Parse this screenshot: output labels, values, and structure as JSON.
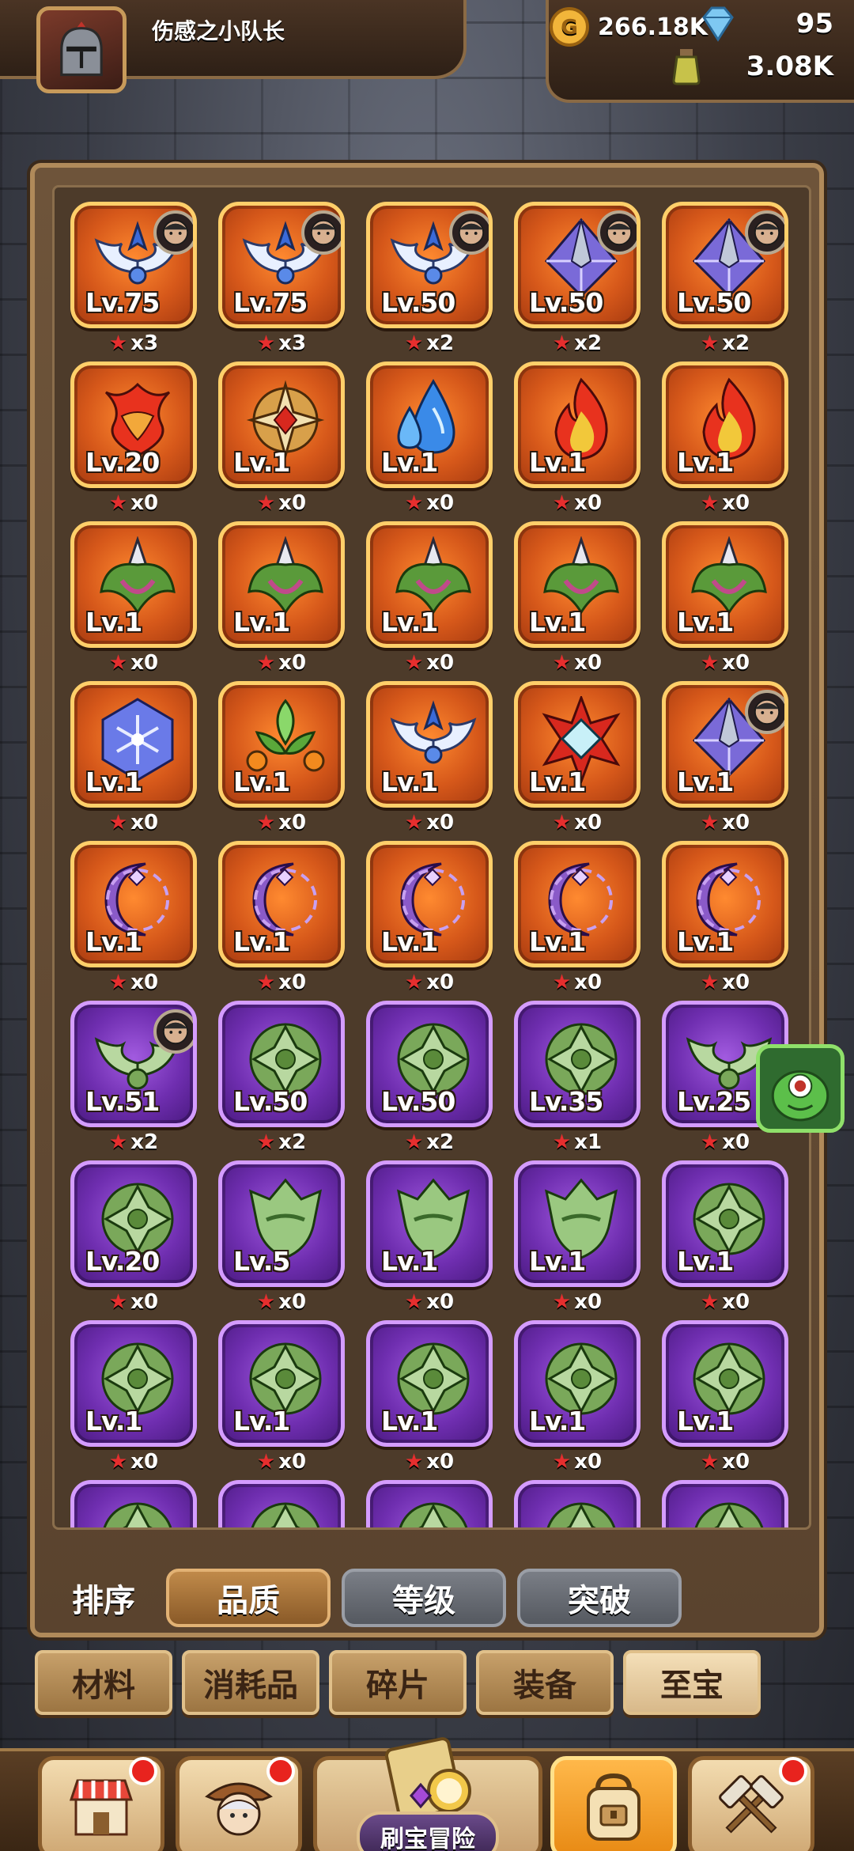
{
  "player": {
    "name": "伤感之小队长"
  },
  "resources": {
    "gold": "266.18K",
    "gems": "95",
    "potion": "3.08K"
  },
  "items": [
    {
      "lv": "Lv.75",
      "stars": "x3",
      "rarity": "orange",
      "art": "wings",
      "hero": true
    },
    {
      "lv": "Lv.75",
      "stars": "x3",
      "rarity": "orange",
      "art": "wings",
      "hero": true
    },
    {
      "lv": "Lv.50",
      "stars": "x2",
      "rarity": "orange",
      "art": "wings",
      "hero": true
    },
    {
      "lv": "Lv.50",
      "stars": "x2",
      "rarity": "orange",
      "art": "spike",
      "hero": true
    },
    {
      "lv": "Lv.50",
      "stars": "x2",
      "rarity": "orange",
      "art": "spike",
      "hero": true
    },
    {
      "lv": "Lv.20",
      "stars": "x0",
      "rarity": "orange",
      "art": "flame-mask",
      "hero": false
    },
    {
      "lv": "Lv.1",
      "stars": "x0",
      "rarity": "orange",
      "art": "cross",
      "hero": false
    },
    {
      "lv": "Lv.1",
      "stars": "x0",
      "rarity": "orange",
      "art": "water",
      "hero": false
    },
    {
      "lv": "Lv.1",
      "stars": "x0",
      "rarity": "orange",
      "art": "fire",
      "hero": false
    },
    {
      "lv": "Lv.1",
      "stars": "x0",
      "rarity": "orange",
      "art": "fire",
      "hero": false
    },
    {
      "lv": "Lv.1",
      "stars": "x0",
      "rarity": "orange",
      "art": "leaf-spike",
      "hero": false
    },
    {
      "lv": "Lv.1",
      "stars": "x0",
      "rarity": "orange",
      "art": "leaf-spike",
      "hero": false
    },
    {
      "lv": "Lv.1",
      "stars": "x0",
      "rarity": "orange",
      "art": "leaf-spike",
      "hero": false
    },
    {
      "lv": "Lv.1",
      "stars": "x0",
      "rarity": "orange",
      "art": "leaf-spike",
      "hero": false
    },
    {
      "lv": "Lv.1",
      "stars": "x0",
      "rarity": "orange",
      "art": "leaf-spike",
      "hero": false
    },
    {
      "lv": "Lv.1",
      "stars": "x0",
      "rarity": "orange",
      "art": "snow-hex",
      "hero": false
    },
    {
      "lv": "Lv.1",
      "stars": "x0",
      "rarity": "orange",
      "art": "green-orbs",
      "hero": false
    },
    {
      "lv": "Lv.1",
      "stars": "x0",
      "rarity": "orange",
      "art": "wings",
      "hero": false
    },
    {
      "lv": "Lv.1",
      "stars": "x0",
      "rarity": "orange",
      "art": "star-gem",
      "hero": false
    },
    {
      "lv": "Lv.1",
      "stars": "x0",
      "rarity": "orange",
      "art": "spike",
      "hero": true
    },
    {
      "lv": "Lv.1",
      "stars": "x0",
      "rarity": "orange",
      "art": "moon",
      "hero": false
    },
    {
      "lv": "Lv.1",
      "stars": "x0",
      "rarity": "orange",
      "art": "moon",
      "hero": false
    },
    {
      "lv": "Lv.1",
      "stars": "x0",
      "rarity": "orange",
      "art": "moon",
      "hero": false
    },
    {
      "lv": "Lv.1",
      "stars": "x0",
      "rarity": "orange",
      "art": "moon",
      "hero": false
    },
    {
      "lv": "Lv.1",
      "stars": "x0",
      "rarity": "orange",
      "art": "moon",
      "hero": false
    },
    {
      "lv": "Lv.51",
      "stars": "x2",
      "rarity": "purple",
      "art": "green-wings",
      "hero": true
    },
    {
      "lv": "Lv.50",
      "stars": "x2",
      "rarity": "purple",
      "art": "green-shield",
      "hero": false
    },
    {
      "lv": "Lv.50",
      "stars": "x2",
      "rarity": "purple",
      "art": "green-shield",
      "hero": false
    },
    {
      "lv": "Lv.35",
      "stars": "x1",
      "rarity": "purple",
      "art": "green-shield",
      "hero": false
    },
    {
      "lv": "Lv.25",
      "stars": "x0",
      "rarity": "purple",
      "art": "green-wings",
      "hero": false
    },
    {
      "lv": "Lv.20",
      "stars": "x0",
      "rarity": "purple",
      "art": "green-shield",
      "hero": false
    },
    {
      "lv": "Lv.5",
      "stars": "x0",
      "rarity": "purple",
      "art": "green-mask",
      "hero": false
    },
    {
      "lv": "Lv.1",
      "stars": "x0",
      "rarity": "purple",
      "art": "green-mask",
      "hero": false
    },
    {
      "lv": "Lv.1",
      "stars": "x0",
      "rarity": "purple",
      "art": "green-mask",
      "hero": false
    },
    {
      "lv": "Lv.1",
      "stars": "x0",
      "rarity": "purple",
      "art": "green-shield",
      "hero": false
    },
    {
      "lv": "Lv.1",
      "stars": "x0",
      "rarity": "purple",
      "art": "green-shield",
      "hero": false
    },
    {
      "lv": "Lv.1",
      "stars": "x0",
      "rarity": "purple",
      "art": "green-shield",
      "hero": false
    },
    {
      "lv": "Lv.1",
      "stars": "x0",
      "rarity": "purple",
      "art": "green-shield",
      "hero": false
    },
    {
      "lv": "Lv.1",
      "stars": "x0",
      "rarity": "purple",
      "art": "green-shield",
      "hero": false
    },
    {
      "lv": "Lv.1",
      "stars": "x0",
      "rarity": "purple",
      "art": "green-shield",
      "hero": false
    },
    {
      "lv": "",
      "stars": "",
      "rarity": "purple",
      "art": "green-shield",
      "hero": false
    },
    {
      "lv": "",
      "stars": "",
      "rarity": "purple",
      "art": "green-shield",
      "hero": false
    },
    {
      "lv": "",
      "stars": "",
      "rarity": "purple",
      "art": "green-shield",
      "hero": false
    },
    {
      "lv": "",
      "stars": "",
      "rarity": "purple",
      "art": "green-shield",
      "hero": false
    },
    {
      "lv": "",
      "stars": "",
      "rarity": "purple",
      "art": "green-shield",
      "hero": false
    }
  ],
  "sort": {
    "label": "排序",
    "options": [
      "品质",
      "等级",
      "突破"
    ],
    "active": 0
  },
  "categories": {
    "tabs": [
      "材料",
      "消耗品",
      "碎片",
      "装备",
      "至宝"
    ],
    "active": 4
  },
  "nav": {
    "center_label": "刷宝冒险"
  },
  "colors": {
    "orange_card": "#d6581a",
    "purple_card": "#6f2eb0",
    "star": "#e62e2e",
    "gold_border": "#ffcf6a"
  }
}
